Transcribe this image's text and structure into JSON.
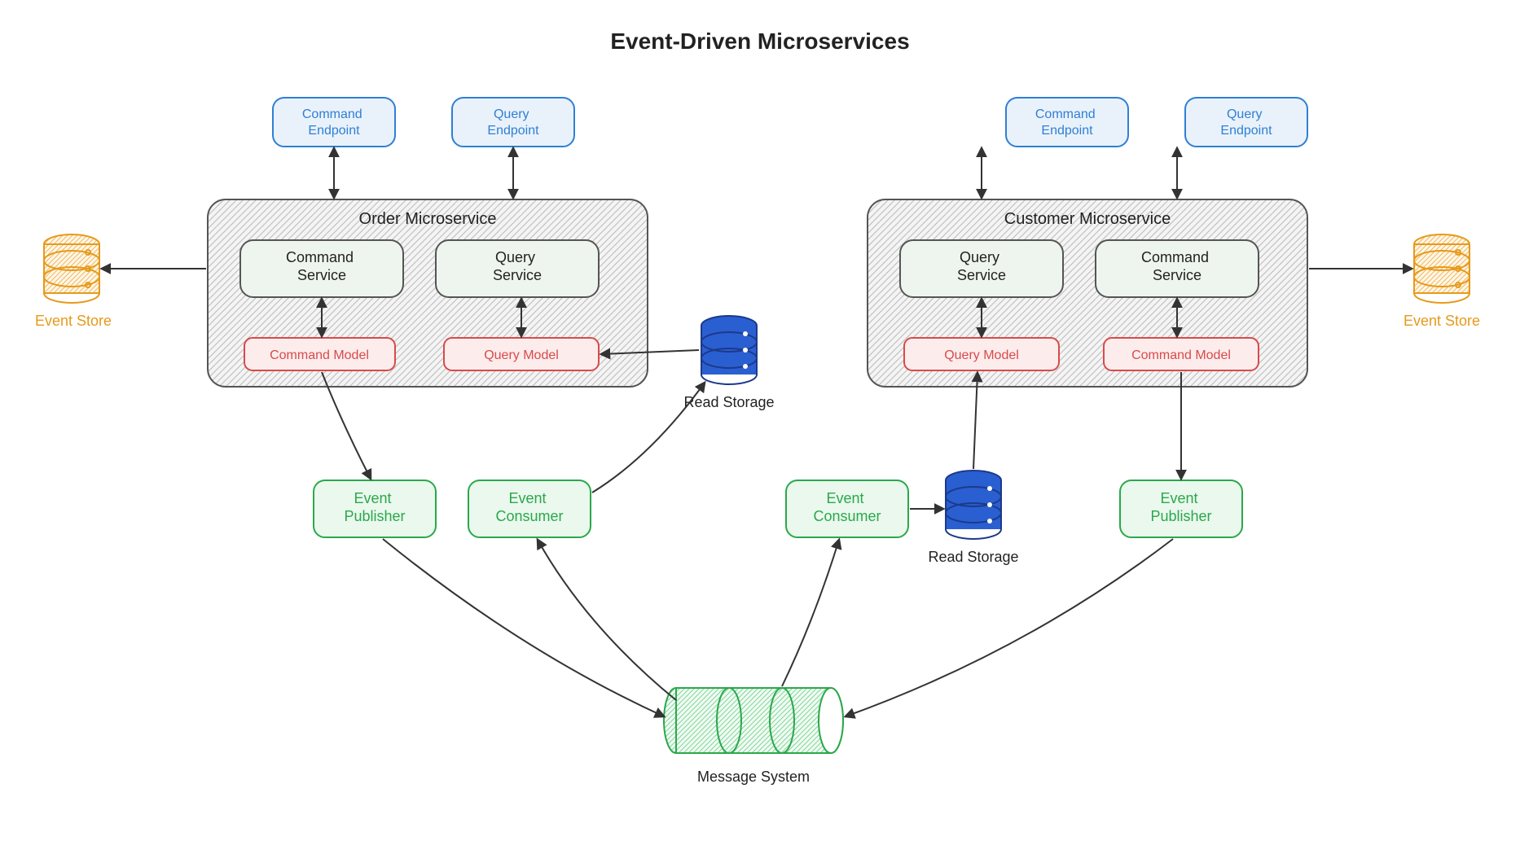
{
  "title": "Event-Driven Microservices",
  "services": {
    "order": {
      "title": "Order Microservice",
      "command_endpoint": "Command\nEndpoint",
      "query_endpoint": "Query\nEndpoint",
      "command_service": "Command\nService",
      "query_service": "Query\nService",
      "command_model": "Command Model",
      "query_model": "Query Model",
      "event_publisher": "Event\nPublisher",
      "event_consumer": "Event\nConsumer"
    },
    "customer": {
      "title": "Customer Microservice",
      "command_endpoint": "Command\nEndpoint",
      "query_endpoint": "Query\nEndpoint",
      "command_service": "Command\nService",
      "query_service": "Query\nService",
      "command_model": "Command Model",
      "query_model": "Query Model",
      "event_publisher": "Event\nPublisher",
      "event_consumer": "Event\nConsumer"
    }
  },
  "stores": {
    "event_store_left": "Event Store",
    "event_store_right": "Event Store",
    "read_storage_left": "Read Storage",
    "read_storage_right": "Read Storage"
  },
  "message_system": "Message System",
  "colors": {
    "blue": "#2f7fd4",
    "green": "#2ba84a",
    "red": "#d94a4a",
    "orange": "#e69a1a",
    "gray": "#555555",
    "dbBlue": "#2a5fd1"
  }
}
